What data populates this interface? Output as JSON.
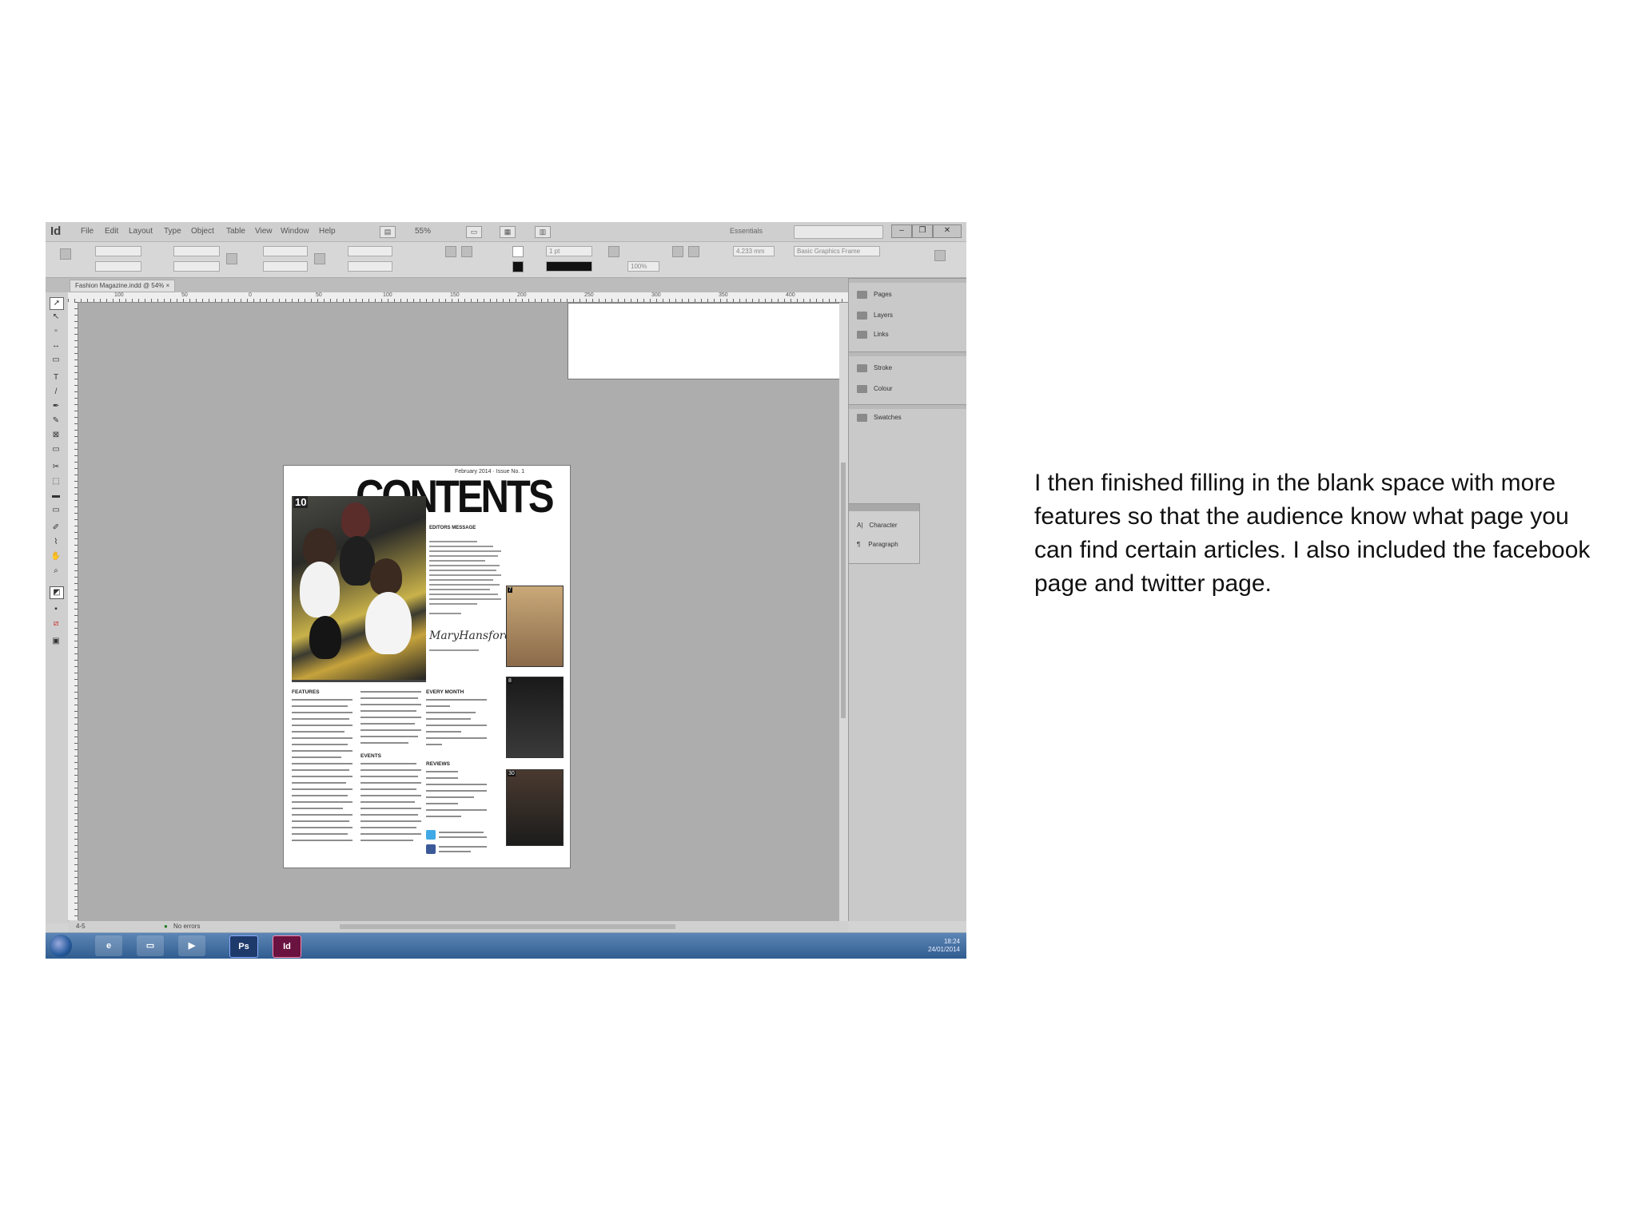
{
  "app": {
    "logo": "Id",
    "menu": [
      "File",
      "Edit",
      "Layout",
      "Type",
      "Object",
      "Table",
      "View",
      "Window",
      "Help"
    ],
    "zoom": "55%",
    "workspace": "Essentials",
    "window_buttons": [
      "–",
      "❐",
      "✕"
    ]
  },
  "document_tab": {
    "label": "Fashion Magazine.indd @ 54%"
  },
  "control_panel": {
    "stroke_weight": "1 pt",
    "object_style": "Basic Graphics Frame",
    "percent": "100%",
    "measure": "4.233 mm"
  },
  "ruler_labels": [
    "100",
    "50",
    "0",
    "50",
    "100",
    "150",
    "200",
    "250",
    "300",
    "350",
    "400"
  ],
  "page": {
    "title": "CONTENTS",
    "issue_line": "February 2014 · Issue No. 1",
    "hero_number": "10",
    "editors_heading": "EDITORS MESSAGE",
    "signature": "MaryHansford",
    "sections": [
      "FEATURES",
      "EVERY MONTH",
      "EVENTS",
      "REVIEWS"
    ],
    "thumb_numbers": [
      "7",
      "8",
      "30"
    ]
  },
  "panels": {
    "group1": [
      "Pages",
      "Layers",
      "Links"
    ],
    "group2": [
      "Stroke",
      "Colour"
    ],
    "group3": [
      "Swatches"
    ],
    "floating": [
      "Character",
      "Paragraph"
    ]
  },
  "status_bar": {
    "page_number": "4-5",
    "preflight": "No errors"
  },
  "taskbar": {
    "apps": [
      "Ps",
      "Id"
    ],
    "time": "18:24",
    "date": "24/01/2014"
  },
  "caption": "I then finished filling in the blank space with more features so that the audience know what page you can find certain articles. I also included the facebook page and twitter page."
}
